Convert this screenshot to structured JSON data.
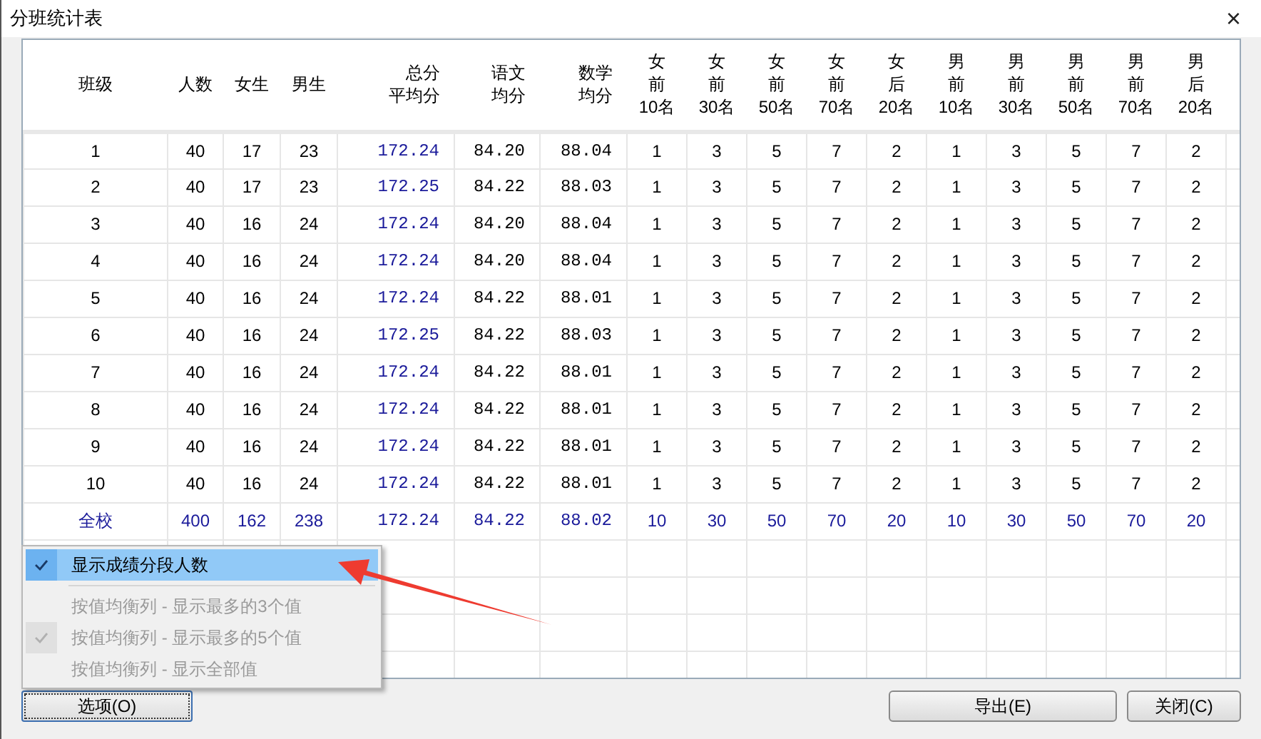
{
  "window": {
    "title": "分班统计表",
    "close": "×"
  },
  "table": {
    "columns": [
      {
        "lines": [
          "班级"
        ],
        "kind": "label"
      },
      {
        "lines": [
          "人数"
        ],
        "kind": "count"
      },
      {
        "lines": [
          "女生"
        ],
        "kind": "count"
      },
      {
        "lines": [
          "男生"
        ],
        "kind": "count"
      },
      {
        "lines": [
          "总分",
          "平均分"
        ],
        "kind": "total_score"
      },
      {
        "lines": [
          "语文",
          "均分"
        ],
        "kind": "score"
      },
      {
        "lines": [
          "数学",
          "均分"
        ],
        "kind": "score"
      },
      {
        "lines": [
          "女",
          "前",
          "10名"
        ],
        "kind": "rank"
      },
      {
        "lines": [
          "女",
          "前",
          "30名"
        ],
        "kind": "rank"
      },
      {
        "lines": [
          "女",
          "前",
          "50名"
        ],
        "kind": "rank"
      },
      {
        "lines": [
          "女",
          "前",
          "70名"
        ],
        "kind": "rank"
      },
      {
        "lines": [
          "女",
          "后",
          "20名"
        ],
        "kind": "rank"
      },
      {
        "lines": [
          "男",
          "前",
          "10名"
        ],
        "kind": "rank"
      },
      {
        "lines": [
          "男",
          "前",
          "30名"
        ],
        "kind": "rank"
      },
      {
        "lines": [
          "男",
          "前",
          "50名"
        ],
        "kind": "rank"
      },
      {
        "lines": [
          "男",
          "前",
          "70名"
        ],
        "kind": "rank"
      },
      {
        "lines": [
          "男",
          "后",
          "20名"
        ],
        "kind": "rank"
      }
    ],
    "rows": [
      {
        "kind": "class",
        "cells": [
          "1",
          "40",
          "17",
          "23",
          "172.24",
          "84.20",
          "88.04",
          "1",
          "3",
          "5",
          "7",
          "2",
          "1",
          "3",
          "5",
          "7",
          "2"
        ]
      },
      {
        "kind": "class",
        "cells": [
          "2",
          "40",
          "17",
          "23",
          "172.25",
          "84.22",
          "88.03",
          "1",
          "3",
          "5",
          "7",
          "2",
          "1",
          "3",
          "5",
          "7",
          "2"
        ]
      },
      {
        "kind": "class",
        "cells": [
          "3",
          "40",
          "16",
          "24",
          "172.24",
          "84.20",
          "88.04",
          "1",
          "3",
          "5",
          "7",
          "2",
          "1",
          "3",
          "5",
          "7",
          "2"
        ]
      },
      {
        "kind": "class",
        "cells": [
          "4",
          "40",
          "16",
          "24",
          "172.24",
          "84.20",
          "88.04",
          "1",
          "3",
          "5",
          "7",
          "2",
          "1",
          "3",
          "5",
          "7",
          "2"
        ]
      },
      {
        "kind": "class",
        "cells": [
          "5",
          "40",
          "16",
          "24",
          "172.24",
          "84.22",
          "88.01",
          "1",
          "3",
          "5",
          "7",
          "2",
          "1",
          "3",
          "5",
          "7",
          "2"
        ]
      },
      {
        "kind": "class",
        "cells": [
          "6",
          "40",
          "16",
          "24",
          "172.25",
          "84.22",
          "88.03",
          "1",
          "3",
          "5",
          "7",
          "2",
          "1",
          "3",
          "5",
          "7",
          "2"
        ]
      },
      {
        "kind": "class",
        "cells": [
          "7",
          "40",
          "16",
          "24",
          "172.24",
          "84.22",
          "88.01",
          "1",
          "3",
          "5",
          "7",
          "2",
          "1",
          "3",
          "5",
          "7",
          "2"
        ]
      },
      {
        "kind": "class",
        "cells": [
          "8",
          "40",
          "16",
          "24",
          "172.24",
          "84.22",
          "88.01",
          "1",
          "3",
          "5",
          "7",
          "2",
          "1",
          "3",
          "5",
          "7",
          "2"
        ]
      },
      {
        "kind": "class",
        "cells": [
          "9",
          "40",
          "16",
          "24",
          "172.24",
          "84.22",
          "88.01",
          "1",
          "3",
          "5",
          "7",
          "2",
          "1",
          "3",
          "5",
          "7",
          "2"
        ]
      },
      {
        "kind": "class",
        "cells": [
          "10",
          "40",
          "16",
          "24",
          "172.24",
          "84.22",
          "88.01",
          "1",
          "3",
          "5",
          "7",
          "2",
          "1",
          "3",
          "5",
          "7",
          "2"
        ]
      },
      {
        "kind": "total",
        "cells": [
          "全校",
          "400",
          "162",
          "238",
          "172.24",
          "84.22",
          "88.02",
          "10",
          "30",
          "50",
          "70",
          "20",
          "10",
          "30",
          "50",
          "70",
          "20"
        ]
      }
    ]
  },
  "menu": {
    "items": [
      {
        "label": "显示成绩分段人数",
        "checked": true,
        "disabled": false,
        "selected": true
      },
      {
        "label": "按值均衡列 - 显示最多的3个值",
        "checked": false,
        "disabled": true,
        "selected": false
      },
      {
        "label": "按值均衡列 - 显示最多的5个值",
        "checked": true,
        "disabled": true,
        "selected": false
      },
      {
        "label": "按值均衡列 - 显示全部值",
        "checked": false,
        "disabled": true,
        "selected": false
      }
    ]
  },
  "buttons": {
    "options": "选项(O)",
    "export": "导出(E)",
    "close": "关闭(C)"
  }
}
